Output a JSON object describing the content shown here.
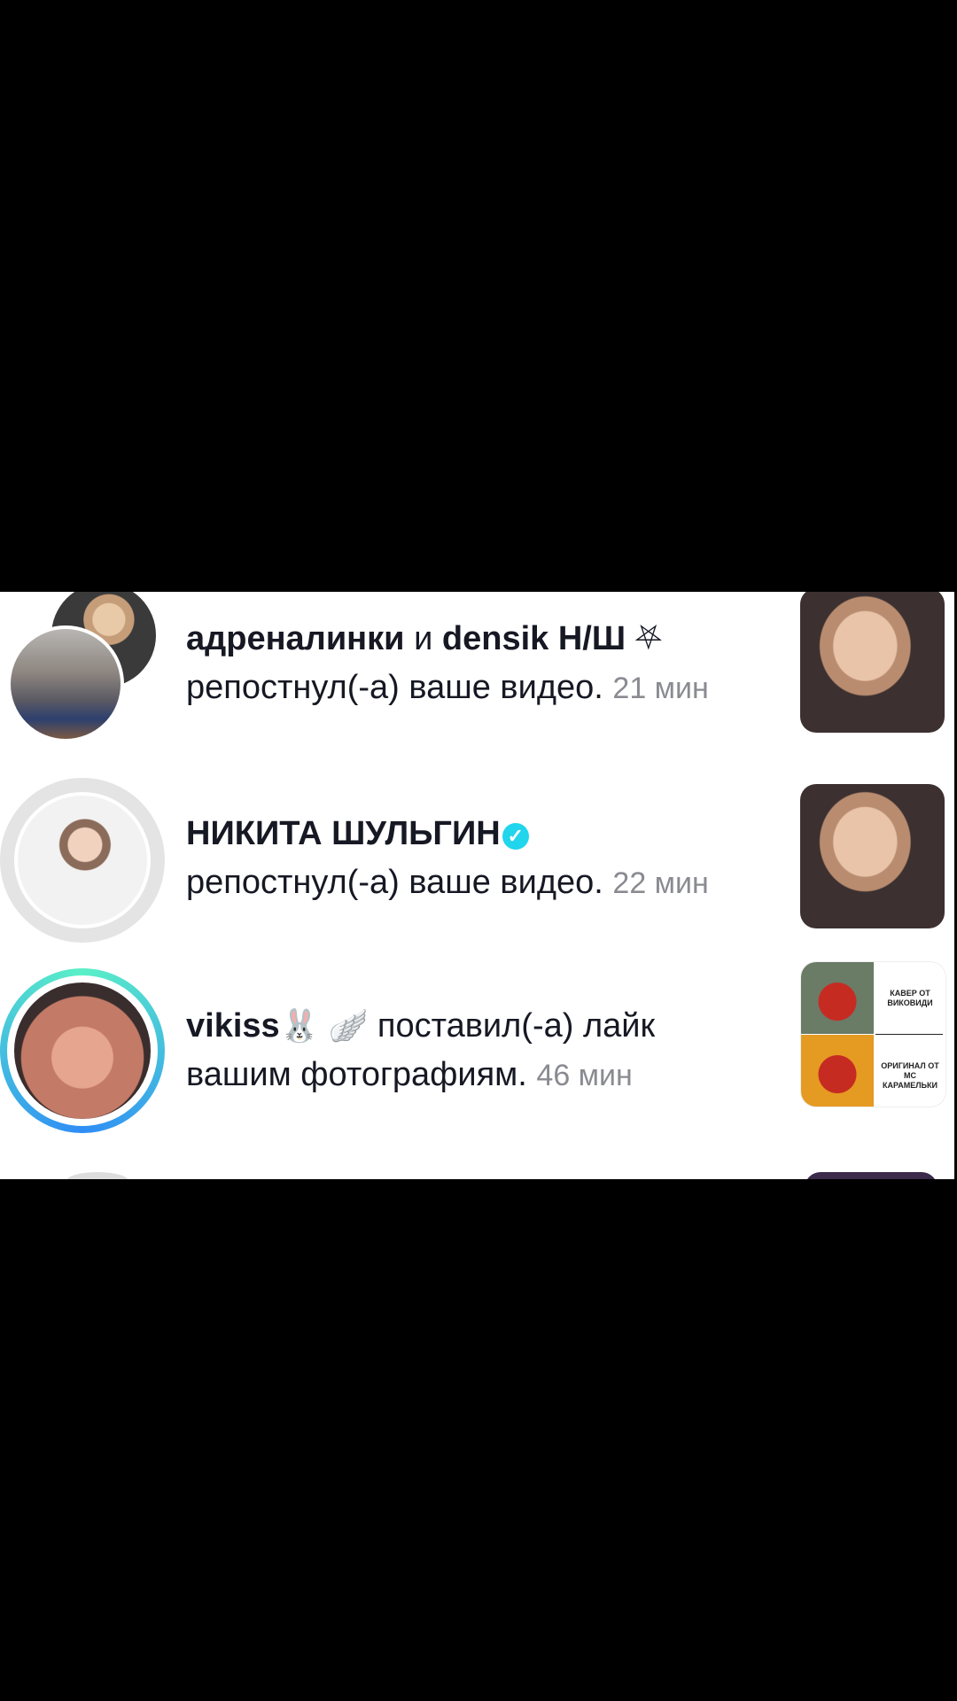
{
  "notifications": [
    {
      "user": "адреналинки",
      "joiner": "и",
      "user2": "densik Н/Ш",
      "user2_suffix": "⛧",
      "action": "репостнул(-а) ваше видео.",
      "time": "21 мин",
      "thumb_icon": "video-thumbnail"
    },
    {
      "user": "НИКИТА ШУЛЬГИН",
      "verified_icon": "verified-badge-icon",
      "action": "репостнул(-а) ваше видео.",
      "time": "22 мин",
      "thumb_icon": "video-thumbnail"
    },
    {
      "user": "vikiss",
      "user_emojis": "🐰 🪽",
      "action_line1": "поставил(-а) лайк",
      "action_line2": "вашим фотографиям.",
      "time": "46 мин",
      "thumb_top_text": "КАВЕР ОТ\nВИКОВИДИ",
      "thumb_bottom_text": "ОРИГИНАЛ ОТ\nМС КАРАМЕЛЬКИ"
    }
  ],
  "colors": {
    "verified": "#20d5ec",
    "time": "#8a8b91",
    "story_ring_start": "#2f8df5",
    "story_ring_end": "#5af0c7"
  }
}
